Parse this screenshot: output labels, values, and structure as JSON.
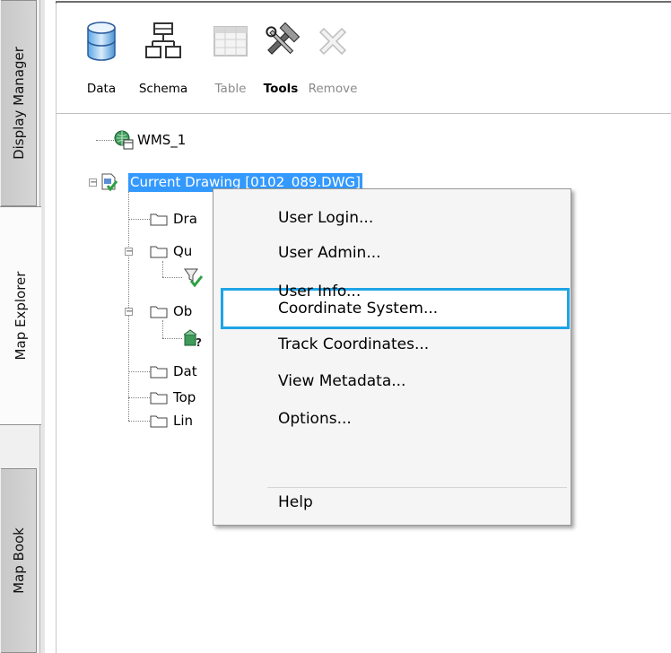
{
  "tabs": [
    {
      "label": "Display Manager",
      "active": false
    },
    {
      "label": "Map Explorer",
      "active": true
    },
    {
      "label": "Map Book",
      "active": false
    }
  ],
  "toolbar": {
    "data_label": "Data",
    "schema_label": "Schema",
    "table_label": "Table",
    "tools_label": "Tools",
    "remove_label": "Remove"
  },
  "tree": {
    "wms": "WMS_1",
    "current_drawing": "Current Drawing [0102_089.DWG]",
    "children": [
      "Dra",
      "Qu",
      "Ob",
      "Dat",
      "Top",
      "Lin"
    ]
  },
  "context_menu": {
    "items": [
      "User Login...",
      "User Admin...",
      "User Info...",
      "Coordinate System...",
      "Track Coordinates...",
      "View Metadata...",
      "Options...",
      "Help"
    ],
    "highlighted": "Coordinate System..."
  },
  "colors": {
    "selection": "#3399ff",
    "menu_highlight_border": "#1ea4e6"
  }
}
